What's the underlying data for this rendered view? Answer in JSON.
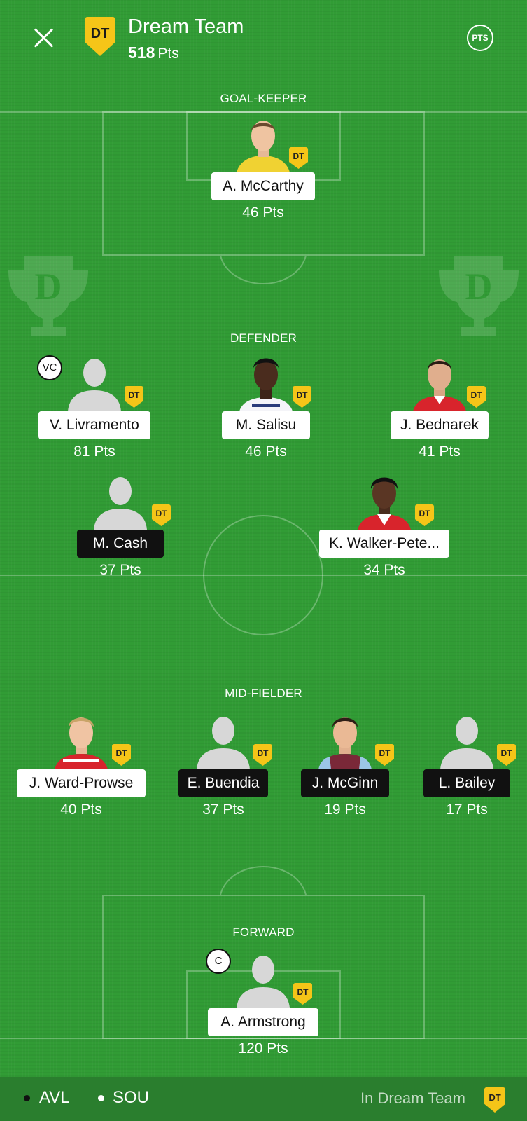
{
  "header": {
    "close_icon": "close-icon",
    "logo_text": "DT",
    "title": "Dream Team",
    "total_points": "518",
    "points_unit": "Pts",
    "pts_toggle_label": "PTS"
  },
  "colors": {
    "pitch": "#319c35",
    "dt_badge": "#f5c518",
    "name_light_bg": "#ffffff",
    "name_dark_bg": "#111111"
  },
  "sections": {
    "goalkeeper": "GOAL-KEEPER",
    "defender": "DEFENDER",
    "midfielder": "MID-FIELDER",
    "forward": "FORWARD"
  },
  "players": {
    "mccarthy": {
      "name": "A. McCarthy",
      "points": "46 Pts",
      "badge": "DT",
      "tag_style": "light"
    },
    "livramento": {
      "name": "V. Livramento",
      "points": "81 Pts",
      "badge": "DT",
      "role": "VC",
      "tag_style": "light"
    },
    "salisu": {
      "name": "M. Salisu",
      "points": "46 Pts",
      "badge": "DT",
      "tag_style": "light"
    },
    "bednarek": {
      "name": "J. Bednarek",
      "points": "41 Pts",
      "badge": "DT",
      "tag_style": "light"
    },
    "cash": {
      "name": "M. Cash",
      "points": "37 Pts",
      "badge": "DT",
      "tag_style": "dark"
    },
    "walker_peters": {
      "name": "K. Walker-Pete...",
      "points": "34 Pts",
      "badge": "DT",
      "tag_style": "light"
    },
    "ward_prowse": {
      "name": "J. Ward-Prowse",
      "points": "40 Pts",
      "badge": "DT",
      "tag_style": "light"
    },
    "buendia": {
      "name": "E. Buendia",
      "points": "37 Pts",
      "badge": "DT",
      "tag_style": "dark"
    },
    "mcginn": {
      "name": "J. McGinn",
      "points": "19 Pts",
      "badge": "DT",
      "tag_style": "dark"
    },
    "bailey": {
      "name": "L. Bailey",
      "points": "17 Pts",
      "badge": "DT",
      "tag_style": "dark"
    },
    "armstrong": {
      "name": "A. Armstrong",
      "points": "120 Pts",
      "badge": "DT",
      "role": "C",
      "tag_style": "light"
    }
  },
  "footer": {
    "team1": "AVL",
    "team1_dot_color": "#111111",
    "team2": "SOU",
    "team2_dot_color": "#ffffff",
    "in_dream_team_label": "In Dream Team",
    "badge": "DT"
  }
}
